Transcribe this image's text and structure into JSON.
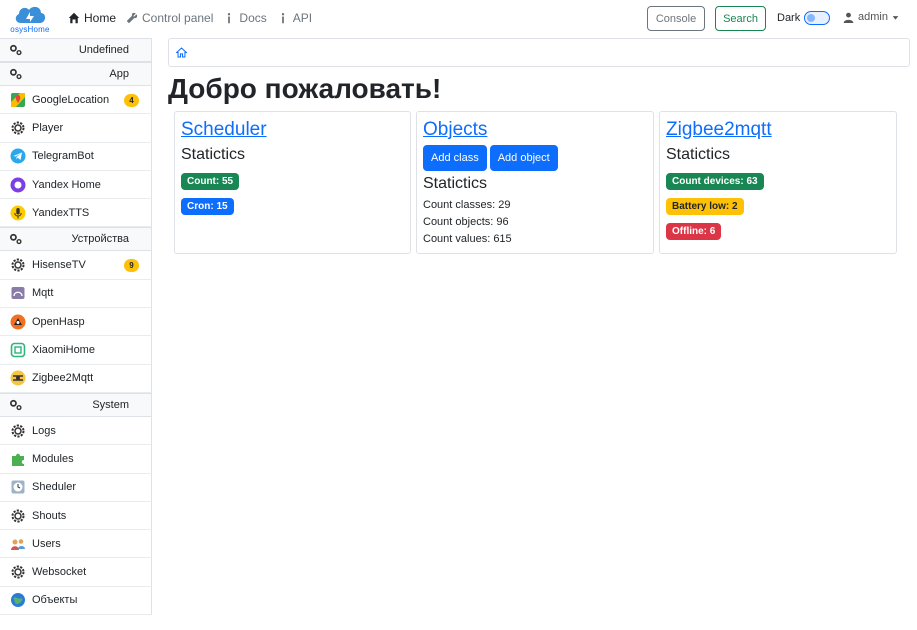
{
  "brand": {
    "logo_text": "osysHome"
  },
  "nav": {
    "home": "Home",
    "control_panel": "Control panel",
    "docs": "Docs",
    "api": "API"
  },
  "toolbar": {
    "console_label": "Console",
    "search_label": "Search",
    "dark_label": "Dark",
    "user_label": "admin"
  },
  "sidebar": {
    "groups": [
      {
        "label": "Undefined",
        "items": []
      },
      {
        "label": "App",
        "items": [
          {
            "label": "GoogleLocation",
            "badge": "4"
          },
          {
            "label": "Player"
          },
          {
            "label": "TelegramBot"
          },
          {
            "label": "Yandex Home"
          },
          {
            "label": "YandexTTS"
          }
        ]
      },
      {
        "label": "Устройства",
        "items": [
          {
            "label": "HisenseTV",
            "badge": "9"
          },
          {
            "label": "Mqtt"
          },
          {
            "label": "OpenHasp"
          },
          {
            "label": "XiaomiHome"
          },
          {
            "label": "Zigbee2Mqtt"
          }
        ]
      },
      {
        "label": "System",
        "items": [
          {
            "label": "Logs"
          },
          {
            "label": "Modules"
          },
          {
            "label": "Sheduler"
          },
          {
            "label": "Shouts"
          },
          {
            "label": "Users"
          },
          {
            "label": "Websocket"
          },
          {
            "label": "Объекты"
          }
        ]
      }
    ]
  },
  "main": {
    "title": "Добро пожаловать!",
    "cards": [
      {
        "title": "Scheduler",
        "subtitle": "Statictics",
        "badges": [
          "Count: 55",
          "Cron: 15"
        ]
      },
      {
        "title": "Objects",
        "buttons": [
          "Add class",
          "Add object"
        ],
        "subtitle": "Statictics",
        "stats": [
          "Count classes: 29",
          "Count objects: 96",
          "Count values: 615"
        ]
      },
      {
        "title": "Zigbee2mqtt",
        "subtitle": "Statictics",
        "badges": [
          "Count devices: 63",
          "Battery low: 2",
          "Offline: 6"
        ]
      }
    ]
  },
  "colors": {
    "primary": "#0d6efd",
    "success": "#198754",
    "warning": "#ffc107",
    "danger": "#dc3545"
  }
}
